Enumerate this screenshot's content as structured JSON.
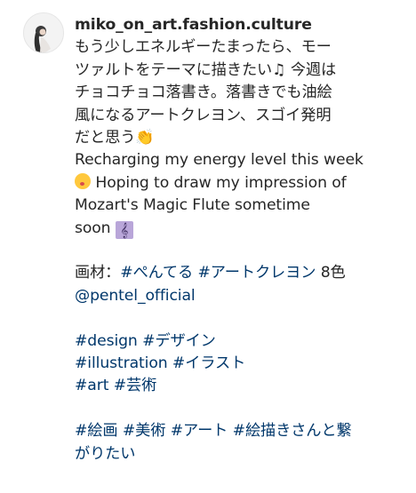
{
  "post": {
    "username": "miko_on_art.fashion.culture",
    "caption_lines": [
      "もう少しエネルギーたまったら、モー",
      "ツァルトをテーマに描きたい",
      " 今週は",
      "チョコチョコ落書き。落書きでも油絵",
      "風になるアートクレヨン、スゴイ発明",
      "だと思う",
      "Recharging my energy level this week",
      " Hoping to draw my impression of",
      "Mozart's Magic Flute sometime",
      "soon "
    ],
    "emojis": {
      "music_note": "♫",
      "clap": "👏",
      "clef": "𝄞"
    },
    "materials": {
      "label": "画材：",
      "tag1": "#ぺんてる",
      "tag2": "#アートクレヨン",
      "count": " 8色",
      "mention": "@pentel_official"
    },
    "hashtags": {
      "design": "#design",
      "design_jp": "#デザイン",
      "illustration": "#illustration",
      "illustration_jp": "#イラスト",
      "art": "#art",
      "art_jp": "#芸術",
      "painting": "#絵画",
      "fine_art": "#美術",
      "art_katakana": "#アート",
      "connect": "#絵描きさんと繋",
      "connect_cont": "がりたい"
    },
    "colors": {
      "text": "#262626",
      "link": "#00376b"
    }
  }
}
